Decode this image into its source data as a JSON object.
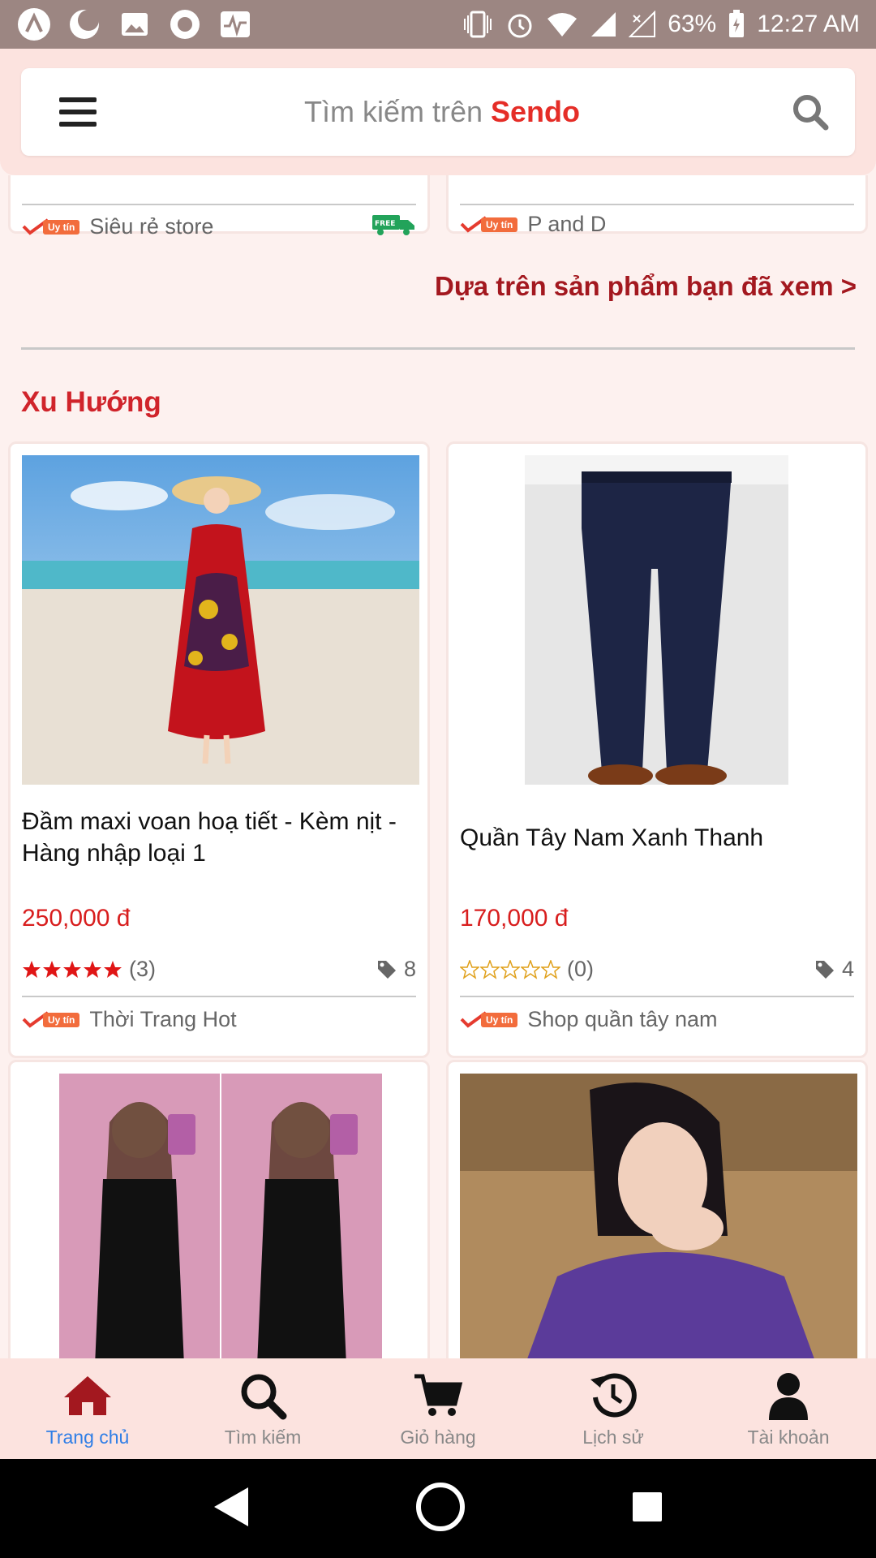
{
  "status_bar": {
    "battery": "63%",
    "time": "12:27 AM"
  },
  "search": {
    "prefix": "Tìm kiếm trên ",
    "brand": "Sendo"
  },
  "previous_cards": [
    {
      "shop": "Siêu rẻ store",
      "badge": "Uy tín",
      "free_ship": true
    },
    {
      "shop": "P and D",
      "badge": "Uy tín"
    }
  ],
  "recommend_link": "Dựa trên sản phẩm bạn đã xem >",
  "section_title": "Xu Hướng",
  "products": [
    {
      "name": "Đầm maxi voan hoạ tiết - Kèm nịt - Hàng nhập loại 1",
      "price": "250,000 đ",
      "rating_stars": 5,
      "rating_count": "(3)",
      "tag_count": "8",
      "badge": "Uy tín",
      "shop": "Thời Trang Hot"
    },
    {
      "name": "Quần Tây Nam Xanh Thanh",
      "price": "170,000 đ",
      "rating_stars": 0,
      "rating_count": "(0)",
      "tag_count": "4",
      "badge": "Uy tín",
      "shop": "Shop quần tây nam"
    }
  ],
  "bottom_nav": [
    {
      "label": "Trang chủ",
      "icon": "home-icon",
      "active": true
    },
    {
      "label": "Tìm kiếm",
      "icon": "search-icon"
    },
    {
      "label": "Giỏ hàng",
      "icon": "cart-icon"
    },
    {
      "label": "Lịch sử",
      "icon": "history-icon"
    },
    {
      "label": "Tài khoản",
      "icon": "account-icon"
    }
  ],
  "colors": {
    "brand_red": "#e52d27",
    "price_red": "#d81e1e",
    "active_blue": "#2f7ee6",
    "header_bg": "#fce3df"
  }
}
